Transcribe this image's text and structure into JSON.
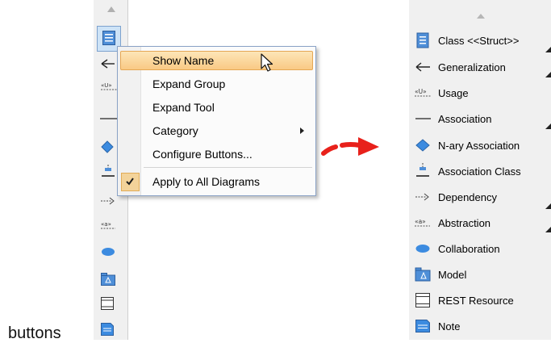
{
  "context_menu": {
    "items": [
      {
        "label": "Show Name"
      },
      {
        "label": "Expand Group"
      },
      {
        "label": "Expand Tool"
      },
      {
        "label": "Category"
      },
      {
        "label": "Configure Buttons..."
      },
      {
        "label": "Apply to All Diagrams",
        "checked": true
      }
    ]
  },
  "right_toolbar": {
    "items": [
      {
        "label": "Class <<Struct>>",
        "icon": "class-icon"
      },
      {
        "label": "Generalization",
        "icon": "generalization-icon"
      },
      {
        "label": "Usage",
        "icon": "usage-icon"
      },
      {
        "label": "Association",
        "icon": "association-icon"
      },
      {
        "label": "N-ary Association",
        "icon": "nary-association-icon"
      },
      {
        "label": "Association Class",
        "icon": "association-class-icon"
      },
      {
        "label": "Dependency",
        "icon": "dependency-icon"
      },
      {
        "label": "Abstraction",
        "icon": "abstraction-icon"
      },
      {
        "label": "Collaboration",
        "icon": "collaboration-icon"
      },
      {
        "label": "Model",
        "icon": "model-icon"
      },
      {
        "label": "REST Resource",
        "icon": "rest-resource-icon"
      },
      {
        "label": "Note",
        "icon": "note-icon"
      }
    ]
  },
  "caption": "buttons",
  "colors": {
    "accent_blue": "#3c8be0",
    "highlight": "#f9c984",
    "arrow_red": "#e8211b"
  }
}
